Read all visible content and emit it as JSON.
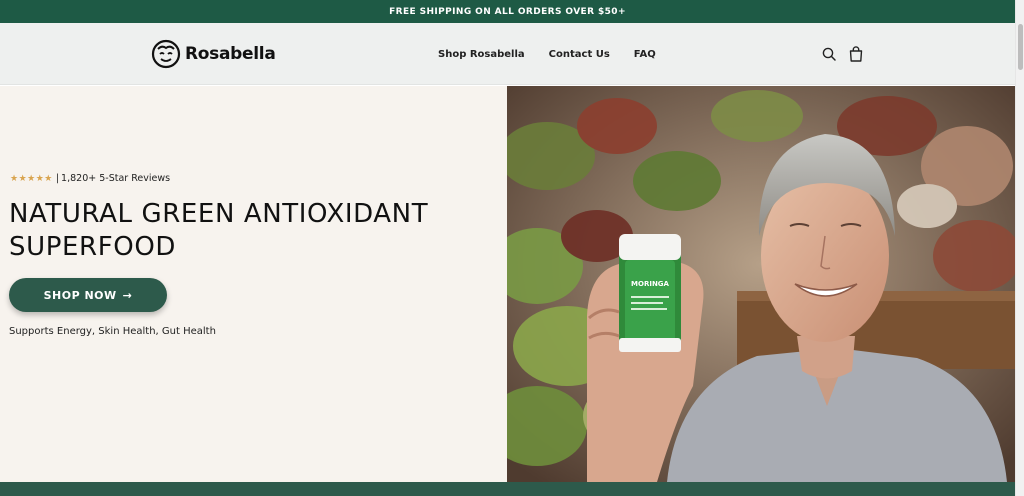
{
  "announcement": {
    "text": "FREE SHIPPING ON ALL ORDERS OVER $50+"
  },
  "header": {
    "logo_text": "Rosabella",
    "nav": [
      {
        "label": "Shop Rosabella"
      },
      {
        "label": "Contact Us"
      },
      {
        "label": "FAQ"
      }
    ],
    "icons": [
      "search-icon",
      "shopping-bag-icon"
    ]
  },
  "hero": {
    "reviews": {
      "stars": "★★★★★",
      "rating_count": 5,
      "separator": "|",
      "text": "1,820+ 5-Star Reviews"
    },
    "headline": "NATURAL GREEN ANTIOXIDANT SUPERFOOD",
    "cta": {
      "label": "SHOP NOW",
      "arrow": "→"
    },
    "benefits": "Supports Energy, Skin Health, Gut Health",
    "product_label": "MORINGA"
  },
  "colors": {
    "brand_green": "#1e5a45",
    "button_green": "#2d5a4b",
    "hero_bg": "#f7f3ee",
    "header_bg": "#eef0ef",
    "star_gold": "#d9a44f"
  }
}
